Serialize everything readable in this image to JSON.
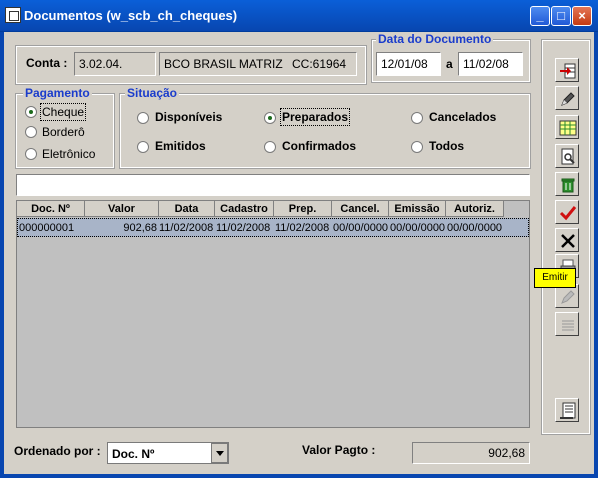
{
  "window": {
    "title": "Documentos (w_scb_ch_cheques)"
  },
  "conta": {
    "label": "Conta :",
    "code": "3.02.04.",
    "bank": "BCO BRASIL MATRIZ",
    "account": "CC:61964"
  },
  "data_documento": {
    "label": "Data do Documento",
    "from": "12/01/08",
    "sep": "a",
    "to": "11/02/08"
  },
  "pagamento": {
    "label": "Pagamento",
    "options": [
      "Cheque",
      "Borderô",
      "Eletrônico"
    ],
    "selected": "Cheque"
  },
  "situacao": {
    "label": "Situação",
    "options": [
      "Disponíveis",
      "Preparados",
      "Cancelados",
      "Emitidos",
      "Confirmados",
      "Todos"
    ],
    "selected": "Preparados"
  },
  "grid": {
    "columns": [
      "Doc. Nº",
      "Valor",
      "Data",
      "Cadastro",
      "Prep.",
      "Cancel.",
      "Emissão",
      "Autoriz."
    ],
    "rows": [
      [
        "000000001",
        "902,68",
        "11/02/2008",
        "11/02/2008",
        "11/02/2008",
        "00/00/0000",
        "00/00/0000",
        "00/00/0000"
      ]
    ]
  },
  "toolbar": {
    "icons": [
      "insert-row-icon",
      "edit-pen-icon",
      "table-grid-icon",
      "print-preview-icon",
      "delete-trash-icon",
      "check-mark-icon",
      "cancel-x-icon",
      "print-icon",
      "sign-pen-icon",
      "align-lines-icon",
      "report-list-icon"
    ],
    "tooltip": "Emitir"
  },
  "footer": {
    "order_label": "Ordenado por :",
    "order_value": "Doc. Nº",
    "valor_label": "Valor Pagto :",
    "valor_value": "902,68"
  },
  "colors": {
    "title_bar": "#0846b0",
    "group_label": "#1a3ccc",
    "row_highlight": "#a8b4c8",
    "tooltip": "#ffff00"
  }
}
